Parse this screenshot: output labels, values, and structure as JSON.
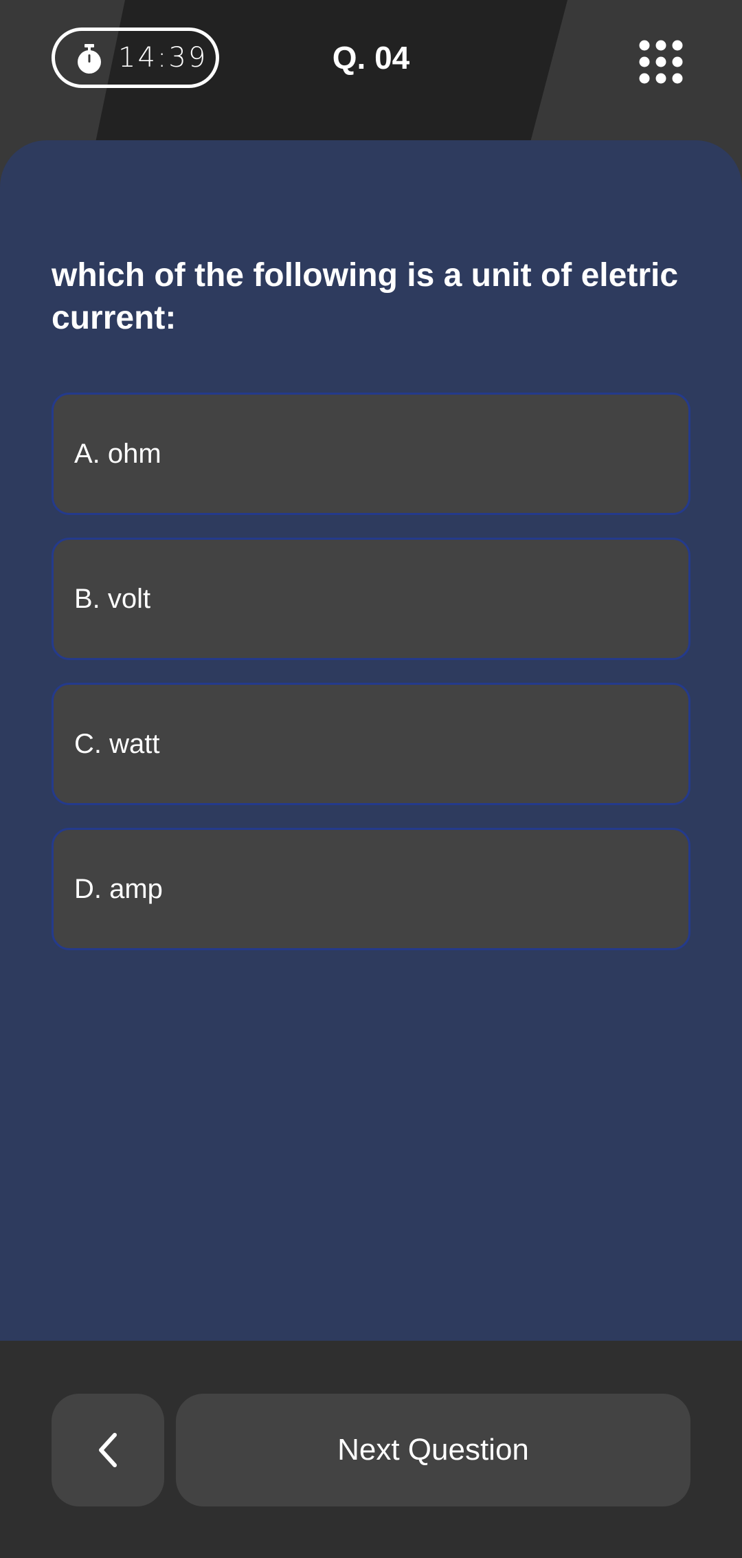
{
  "header": {
    "timer_icon": "stopwatch-icon",
    "timer": "14:39",
    "question_number": "Q. 04",
    "menu_icon": "grid-menu-icon"
  },
  "question": {
    "text": "which of the following is a unit of eletric current:"
  },
  "options": [
    {
      "label": "A. ohm"
    },
    {
      "label": "B. volt"
    },
    {
      "label": "C. watt"
    },
    {
      "label": "D. amp"
    }
  ],
  "footer": {
    "back_icon": "chevron-left-icon",
    "next_label": "Next Question"
  },
  "colors": {
    "page_background": "#393939",
    "header_stripe": "#222222",
    "card_background": "#2e3b5e",
    "option_background": "#434343",
    "option_border": "#243a8c",
    "bottom_bar": "#2f2f2f",
    "button_background": "#434343",
    "text": "#ffffff"
  }
}
